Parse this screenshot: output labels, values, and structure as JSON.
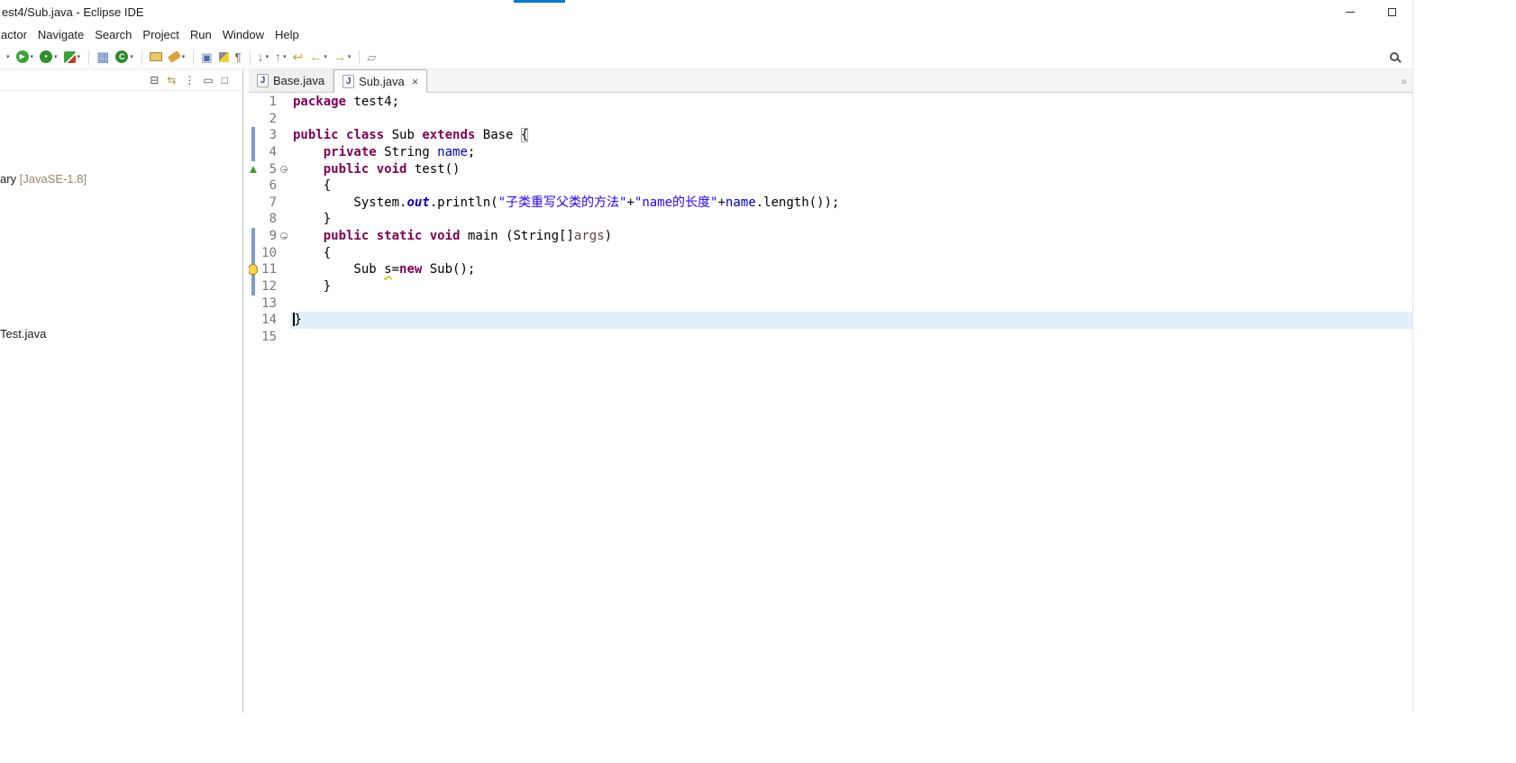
{
  "window": {
    "title": "est4/Sub.java - Eclipse IDE",
    "accent_color": "#0b79d0"
  },
  "menu": {
    "items": [
      "actor",
      "Navigate",
      "Search",
      "Project",
      "Run",
      "Window",
      "Help"
    ]
  },
  "toolbar": {
    "caret_glyph": "▾",
    "items": [
      {
        "name": "toolbar-overflow-caret",
        "kind": "caretonly"
      },
      {
        "name": "run-button",
        "kind": "run",
        "glyph": "▶",
        "caret": true
      },
      {
        "name": "debug-button",
        "kind": "debug",
        "glyph": "●",
        "caret": true
      },
      {
        "name": "coverage-button",
        "kind": "coverage",
        "caret": true
      },
      {
        "kind": "sep"
      },
      {
        "name": "new-java-project-button",
        "kind": "grid",
        "glyph": "▦"
      },
      {
        "name": "new-class-button",
        "kind": "classicon",
        "glyph": "C",
        "caret": true
      },
      {
        "kind": "sep"
      },
      {
        "name": "import-folder-button",
        "kind": "folder"
      },
      {
        "name": "search-flashlight-button",
        "kind": "flash",
        "caret": true
      },
      {
        "kind": "sep"
      },
      {
        "name": "open-task-button",
        "kind": "task",
        "glyph": "▣"
      },
      {
        "name": "mark-occurrences-button",
        "kind": "highlighter"
      },
      {
        "name": "show-whitespace-button",
        "kind": "pilcrow",
        "glyph": "¶"
      },
      {
        "kind": "sep"
      },
      {
        "name": "next-annotation-button",
        "kind": "arrow",
        "glyph": "↓",
        "caret": true
      },
      {
        "name": "previous-annotation-button",
        "kind": "arrow",
        "glyph": "↑",
        "caret": true
      },
      {
        "name": "last-edit-location-button",
        "kind": "goldarrow",
        "glyph": "↩"
      },
      {
        "name": "back-button",
        "kind": "goldarrow",
        "glyph": "←",
        "caret": true
      },
      {
        "name": "forward-button",
        "kind": "goldarrow",
        "glyph": "→",
        "caret": true
      },
      {
        "kind": "sep"
      },
      {
        "name": "pin-editor-button",
        "kind": "pin",
        "glyph": "▱"
      }
    ],
    "right": [
      {
        "name": "search-icon",
        "kind": "magnifier"
      }
    ]
  },
  "explorer": {
    "toolbar": [
      {
        "name": "collapse-all-icon",
        "glyph": "⊟",
        "gold": false
      },
      {
        "name": "link-with-editor-icon",
        "glyph": "⇆",
        "gold": true
      },
      {
        "name": "view-menu-icon",
        "glyph": "⋮",
        "gold": false
      },
      {
        "name": "minimize-view-icon",
        "glyph": "▭",
        "gold": false
      },
      {
        "name": "maximize-view-icon",
        "glyph": "□",
        "gold": false
      }
    ],
    "items": [
      {
        "label": "ary ",
        "decoration": "[JavaSE-1.8]"
      },
      {
        "label": "Test.java",
        "decoration": ""
      }
    ]
  },
  "tabs": [
    {
      "label": "Base.java",
      "icon": "J",
      "active": false,
      "close": ""
    },
    {
      "label": "Sub.java",
      "icon": "J",
      "active": true,
      "close": "×"
    }
  ],
  "editor": {
    "tab_overflow_glyph": "»",
    "colors": {
      "keyword": "#7f0055",
      "string": "#2a00ff",
      "field": "#0000c0",
      "parameter": "#6a3e3e",
      "line_number": "#787878",
      "current_line_bg": "#e3f0fc",
      "change_bar": "#7e9cc9",
      "override_marker": "#3f9c35"
    },
    "lines": [
      {
        "num": "1",
        "segs": [
          {
            "t": "package",
            "c": "kw"
          },
          {
            "t": " test4;",
            "c": "pl"
          }
        ]
      },
      {
        "num": "2",
        "segs": []
      },
      {
        "num": "3",
        "ann": "bar",
        "segs": [
          {
            "t": "public",
            "c": "kw"
          },
          {
            "t": " ",
            "c": "pl"
          },
          {
            "t": "class",
            "c": "kw"
          },
          {
            "t": " Sub ",
            "c": "pl"
          },
          {
            "t": "extends",
            "c": "kw"
          },
          {
            "t": " Base ",
            "c": "pl"
          },
          {
            "t": "{",
            "c": "pl bm"
          }
        ]
      },
      {
        "num": "4",
        "ann": "bar",
        "segs": [
          {
            "t": "    ",
            "c": "pl"
          },
          {
            "t": "private",
            "c": "kw"
          },
          {
            "t": " String ",
            "c": "pl"
          },
          {
            "t": "name",
            "c": "fld"
          },
          {
            "t": ";",
            "c": "pl"
          }
        ]
      },
      {
        "num": "5",
        "fold": true,
        "ann": "override",
        "segs": [
          {
            "t": "    ",
            "c": "pl"
          },
          {
            "t": "public",
            "c": "kw"
          },
          {
            "t": " ",
            "c": "pl"
          },
          {
            "t": "void",
            "c": "kw"
          },
          {
            "t": " test()",
            "c": "pl"
          }
        ]
      },
      {
        "num": "6",
        "segs": [
          {
            "t": "    {",
            "c": "pl"
          }
        ]
      },
      {
        "num": "7",
        "segs": [
          {
            "t": "        System.",
            "c": "pl"
          },
          {
            "t": "out",
            "c": "sf"
          },
          {
            "t": ".println(",
            "c": "pl"
          },
          {
            "t": "\"子类重写父类的方法\"",
            "c": "str"
          },
          {
            "t": "+",
            "c": "pl"
          },
          {
            "t": "\"name的长度\"",
            "c": "str"
          },
          {
            "t": "+",
            "c": "pl"
          },
          {
            "t": "name",
            "c": "fld"
          },
          {
            "t": ".length());",
            "c": "pl"
          }
        ]
      },
      {
        "num": "8",
        "segs": [
          {
            "t": "    }",
            "c": "pl"
          }
        ]
      },
      {
        "num": "9",
        "fold": true,
        "ann": "bar",
        "segs": [
          {
            "t": "    ",
            "c": "pl"
          },
          {
            "t": "public",
            "c": "kw"
          },
          {
            "t": " ",
            "c": "pl"
          },
          {
            "t": "static",
            "c": "kw"
          },
          {
            "t": " ",
            "c": "pl"
          },
          {
            "t": "void",
            "c": "kw"
          },
          {
            "t": " main (String[]",
            "c": "pl"
          },
          {
            "t": "args",
            "c": "par"
          },
          {
            "t": ")",
            "c": "pl"
          }
        ]
      },
      {
        "num": "10",
        "ann": "bar",
        "segs": [
          {
            "t": "    {",
            "c": "pl"
          }
        ]
      },
      {
        "num": "11",
        "ann": "warnbar",
        "segs": [
          {
            "t": "        Sub ",
            "c": "pl"
          },
          {
            "t": "s",
            "c": "pl warn"
          },
          {
            "t": "=",
            "c": "pl"
          },
          {
            "t": "new",
            "c": "kw"
          },
          {
            "t": " Sub();",
            "c": "pl"
          }
        ]
      },
      {
        "num": "12",
        "ann": "bar",
        "segs": [
          {
            "t": "    }",
            "c": "pl"
          }
        ]
      },
      {
        "num": "13",
        "segs": []
      },
      {
        "num": "14",
        "current": true,
        "cursor": true,
        "segs": [
          {
            "t": "}",
            "c": "pl"
          }
        ]
      },
      {
        "num": "15",
        "segs": []
      }
    ]
  }
}
